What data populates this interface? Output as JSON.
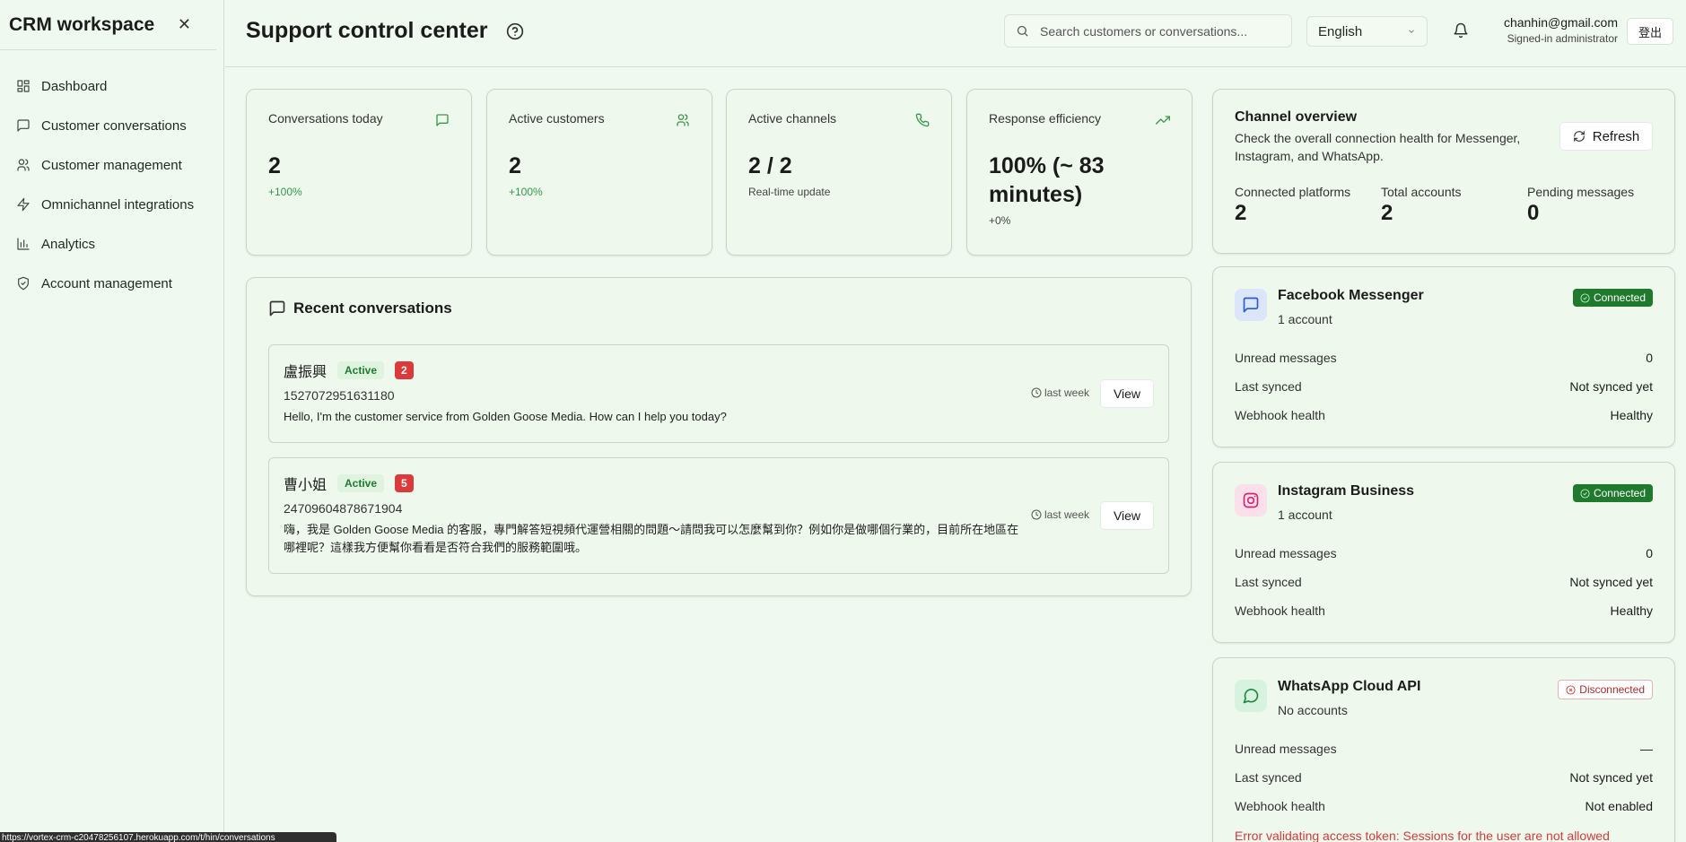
{
  "sidebar": {
    "title": "CRM workspace",
    "close": "✕",
    "items": [
      {
        "label": "Dashboard",
        "icon": "dashboard-icon"
      },
      {
        "label": "Customer conversations",
        "icon": "chat-icon"
      },
      {
        "label": "Customer management",
        "icon": "users-icon"
      },
      {
        "label": "Omnichannel integrations",
        "icon": "bolt-icon"
      },
      {
        "label": "Analytics",
        "icon": "bar-chart-icon"
      },
      {
        "label": "Account management",
        "icon": "shield-icon"
      }
    ]
  },
  "header": {
    "title": "Support control center",
    "search_placeholder": "Search customers or conversations...",
    "language": "English",
    "user_email": "chanhin@gmail.com",
    "user_role": "Signed-in administrator",
    "logout": "登出"
  },
  "stats": [
    {
      "label": "Conversations today",
      "value": "2",
      "sub": "+100%",
      "icon": "chat-icon"
    },
    {
      "label": "Active customers",
      "value": "2",
      "sub": "+100%",
      "icon": "users-icon"
    },
    {
      "label": "Active channels",
      "value": "2 / 2",
      "sub": "Real-time update",
      "icon": "phone-icon"
    },
    {
      "label": "Response efficiency",
      "value": "100% (~ 83 minutes)",
      "sub": "+0%",
      "icon": "trending-up-icon"
    }
  ],
  "recent": {
    "title": "Recent conversations",
    "items": [
      {
        "name": "盧振興",
        "status": "Active",
        "count": "2",
        "id": "1527072951631180",
        "message": "Hello, I'm the customer service from Golden Goose Media. How can I help you today?",
        "time": "last week",
        "view": "View"
      },
      {
        "name": "曹小姐",
        "status": "Active",
        "count": "5",
        "id": "24709604878671904",
        "message": "嗨，我是 Golden Goose Media 的客服，專門解答短視頻代運營相關的問題～請問我可以怎麼幫到你？例如你是做哪個行業的，目前所在地區在哪裡呢？這樣我方便幫你看看是否符合我們的服務範圍哦。",
        "time": "last week",
        "view": "View"
      }
    ]
  },
  "overview": {
    "title": "Channel overview",
    "description": "Check the overall connection health for Messenger, Instagram, and WhatsApp.",
    "refresh": "Refresh",
    "stats": [
      {
        "label": "Connected platforms",
        "value": "2"
      },
      {
        "label": "Total accounts",
        "value": "2"
      },
      {
        "label": "Pending messages",
        "value": "0"
      }
    ]
  },
  "channels": [
    {
      "name": "Facebook Messenger",
      "accounts": "1 account",
      "status": "Connected",
      "icon": "messenger-icon",
      "rows": [
        {
          "label": "Unread messages",
          "value": "0"
        },
        {
          "label": "Last synced",
          "value": "Not synced yet"
        },
        {
          "label": "Webhook health",
          "value": "Healthy"
        }
      ]
    },
    {
      "name": "Instagram Business",
      "accounts": "1 account",
      "status": "Connected",
      "icon": "instagram-icon",
      "rows": [
        {
          "label": "Unread messages",
          "value": "0"
        },
        {
          "label": "Last synced",
          "value": "Not synced yet"
        },
        {
          "label": "Webhook health",
          "value": "Healthy"
        }
      ]
    },
    {
      "name": "WhatsApp Cloud API",
      "accounts": "No accounts",
      "status": "Disconnected",
      "icon": "whatsapp-icon",
      "rows": [
        {
          "label": "Unread messages",
          "value": "—"
        },
        {
          "label": "Last synced",
          "value": "Not synced yet"
        },
        {
          "label": "Webhook health",
          "value": "Not enabled"
        }
      ],
      "error": "Error validating access token: Sessions for the user are not allowed"
    }
  ],
  "status_bar": "https://vortex-crm-c20478256107.herokuapp.com/t/hin/conversations",
  "colors": {
    "background": "#f0f9ef",
    "accent": "#2f9a47",
    "connected": "#1f7a2e",
    "error": "#d43a3a",
    "badge_count": "#dc3a3a"
  }
}
